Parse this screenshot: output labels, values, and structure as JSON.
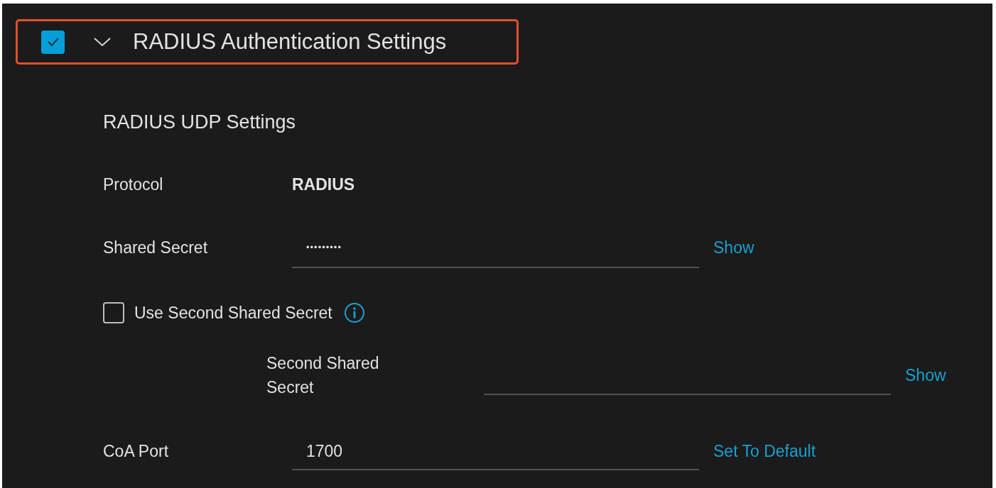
{
  "header": {
    "checked": true,
    "expanded": true,
    "highlighted": true,
    "title": "RADIUS Authentication Settings"
  },
  "section_title": "RADIUS UDP Settings",
  "rows": [
    {
      "kind": "value",
      "label": "Protocol",
      "value": "RADIUS"
    },
    {
      "kind": "field",
      "label": "Shared Secret",
      "value": "•••••••••",
      "secret": true,
      "action": "Show"
    },
    {
      "kind": "checkbox",
      "label": "Use Second Shared Secret",
      "checked": false,
      "info": true
    },
    {
      "kind": "field",
      "label": "Second Shared Secret",
      "indented": true,
      "action": "Show"
    },
    {
      "kind": "field",
      "label": "CoA Port",
      "value": "1700",
      "action": "Set To Default"
    }
  ]
}
